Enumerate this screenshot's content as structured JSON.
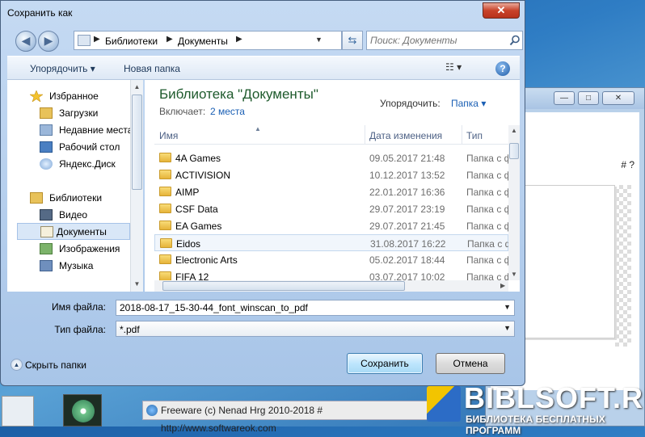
{
  "dialog": {
    "title": "Сохранить как",
    "close_label": "✕"
  },
  "navigation": {
    "back_glyph": "◀",
    "forward_glyph": "▶",
    "breadcrumb": [
      "Библиотеки",
      "Документы"
    ],
    "refresh_glyph": "⇆",
    "search_placeholder": "Поиск: Документы"
  },
  "toolbar": {
    "organize_label": "Упорядочить ▾",
    "new_folder_label": "Новая папка",
    "view_label": "☷ ▾",
    "help_label": "?"
  },
  "nav_pane": {
    "favorites_header": "Избранное",
    "favorites": [
      "Загрузки",
      "Недавние места",
      "Рабочий стол",
      "Яндекс.Диск"
    ],
    "libraries_header": "Библиотеки",
    "libraries": [
      "Видео",
      "Документы",
      "Изображения",
      "Музыка"
    ],
    "selected": "Документы"
  },
  "content": {
    "library_title": "Библиотека \"Документы\"",
    "includes_label": "Включает:",
    "includes_link": "2 места",
    "arrange_label": "Упорядочить:",
    "arrange_value": "Папка ▾",
    "columns": [
      "Имя",
      "Дата изменения",
      "Тип"
    ],
    "rows": [
      {
        "name": "4A Games",
        "date": "09.05.2017 21:48",
        "type": "Папка с ф"
      },
      {
        "name": "ACTIVISION",
        "date": "10.12.2017 13:52",
        "type": "Папка с ф"
      },
      {
        "name": "AIMP",
        "date": "22.01.2017 16:36",
        "type": "Папка с ф"
      },
      {
        "name": "CSF Data",
        "date": "29.07.2017 23:19",
        "type": "Папка с ф"
      },
      {
        "name": "EA Games",
        "date": "29.07.2017 21:45",
        "type": "Папка с ф"
      },
      {
        "name": "Eidos",
        "date": "31.08.2017 16:22",
        "type": "Папка с ф"
      },
      {
        "name": "Electronic Arts",
        "date": "05.02.2017 18:44",
        "type": "Папка с ф"
      },
      {
        "name": "FIFA 12",
        "date": "03.07.2017 10:02",
        "type": "Папка с ф"
      }
    ]
  },
  "form": {
    "filename_label": "Имя файла:",
    "filename_value": "2018-08-17_15-30-44_font_winscan_to_pdf",
    "filetype_label": "Тип файла:",
    "filetype_value": "*.pdf"
  },
  "footer": {
    "hide_folders_label": "Скрыть папки",
    "save_label": "Сохранить",
    "cancel_label": "Отмена"
  },
  "background": {
    "status_text": "Freeware (c) Nenad Hrg 2010-2018 # http://www.softwareok.com",
    "side_text": "# ?",
    "ctrl_minimize": "—",
    "ctrl_maximize": "□",
    "ctrl_close": "✕"
  },
  "watermark": {
    "title": "BIBLSOFT.RU",
    "subtitle": "БИБЛИОТЕКА БЕСПЛАТНЫХ ПРОГРАММ"
  }
}
